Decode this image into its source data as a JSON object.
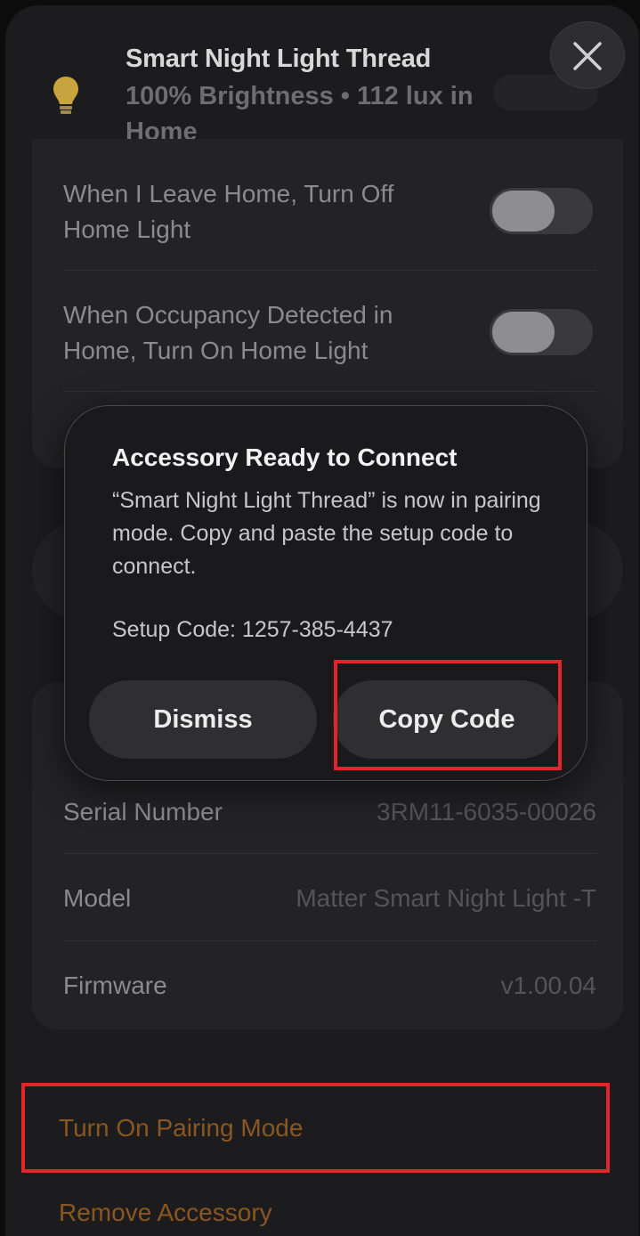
{
  "header": {
    "title": "Smart Night Light Thread",
    "subtitle": "100% Brightness • 112 lux in Home",
    "icon": "lightbulb-icon",
    "close_icon": "close-icon"
  },
  "automations": [
    {
      "label": "When I Leave Home, Turn Off Home Light",
      "enabled": false
    },
    {
      "label": "When Occupancy Detected in Home, Turn On Home Light",
      "enabled": false
    }
  ],
  "dialog": {
    "title": "Accessory Ready to Connect",
    "message": "“Smart Night Light Thread” is now in pairing mode. Copy and paste the setup code to connect.",
    "setup_code": "Setup Code: 1257-385-4437",
    "dismiss_label": "Dismiss",
    "copy_label": "Copy Code"
  },
  "info": [
    {
      "label": "Serial Number",
      "value": "3RM11-6035-00026"
    },
    {
      "label": "Model",
      "value": "Matter Smart Night Light -T"
    },
    {
      "label": "Firmware",
      "value": "v1.00.04"
    }
  ],
  "actions": {
    "pairing_label": "Turn On Pairing Mode",
    "remove_label": "Remove Accessory"
  },
  "colors": {
    "accent": "#8a5722",
    "highlight": "#e3242b",
    "background": "#1c1c1e"
  }
}
